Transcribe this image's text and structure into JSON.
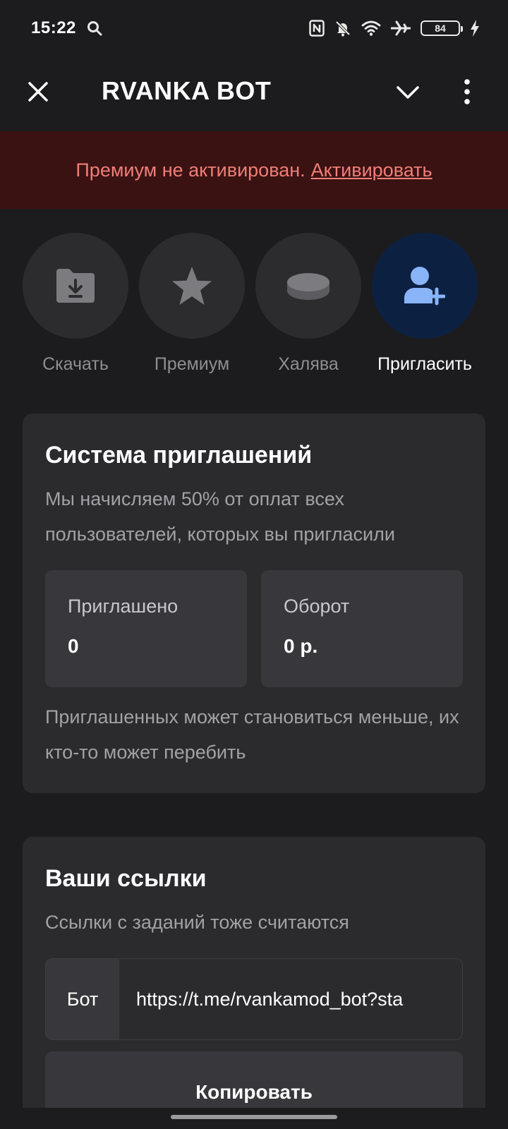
{
  "status_bar": {
    "time": "15:22",
    "battery": "84",
    "icons": [
      "search-icon",
      "nfc-icon",
      "bell-off-icon",
      "wifi-icon",
      "airplane-icon",
      "battery-icon",
      "charging-icon"
    ]
  },
  "header": {
    "title": "RVANKA BOT",
    "icons": [
      "close-icon",
      "chevron-down-icon",
      "more-vertical-icon"
    ]
  },
  "premium_banner": {
    "text": "Премиум не активирован.",
    "link": "Активировать",
    "background": "#3a1212",
    "color": "#f07e78"
  },
  "actions": [
    {
      "label": "Скачать",
      "icon": "folder-download-icon",
      "active": false
    },
    {
      "label": "Премиум",
      "icon": "star-icon",
      "active": false
    },
    {
      "label": "Халява",
      "icon": "coins-icon",
      "active": false
    },
    {
      "label": "Пригласить",
      "icon": "add-user-icon",
      "active": true
    }
  ],
  "invite_card": {
    "title": "Система приглашений",
    "description": "Мы начисляем 50% от оплат всех пользователей, которых вы пригласили",
    "stats": [
      {
        "label": "Приглашено",
        "value": "0"
      },
      {
        "label": "Оборот",
        "value": "0 р."
      }
    ],
    "note": "Приглашенных может становиться меньше, их кто-то может перебить"
  },
  "links_card": {
    "title": "Ваши ссылки",
    "description": "Ссылки с заданий тоже считаются",
    "link_tag": "Бот",
    "link_value": "https://t.me/rvankamod_bot?sta",
    "copy_label": "Копировать"
  },
  "colors": {
    "background": "#1c1c1e",
    "card": "#2b2b2e",
    "accent": "#8ab4f8",
    "accent_bg": "#0c2142"
  }
}
